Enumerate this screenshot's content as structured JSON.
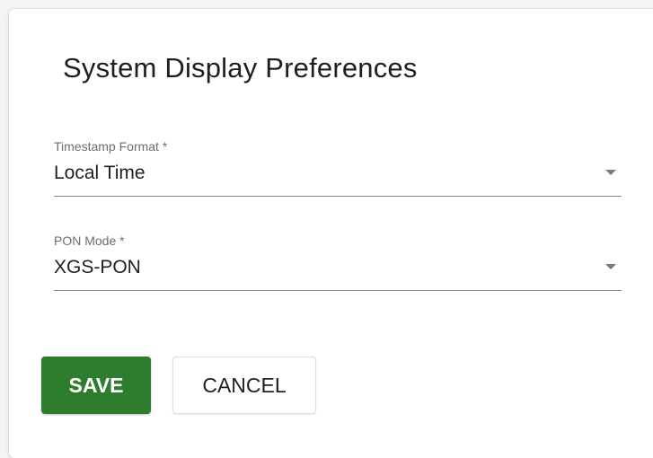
{
  "dialog": {
    "title": "System Display Preferences",
    "fields": [
      {
        "label": "Timestamp Format *",
        "value": "Local Time"
      },
      {
        "label": "PON Mode *",
        "value": "XGS-PON"
      }
    ],
    "buttons": {
      "save_label": "SAVE",
      "cancel_label": "CANCEL"
    }
  },
  "colors": {
    "save_button_bg": "#2e7d2e",
    "dialog_bg": "#ffffff",
    "underline": "#8c8c8c"
  },
  "icons": {
    "dropdown": "chevron-down-icon"
  }
}
